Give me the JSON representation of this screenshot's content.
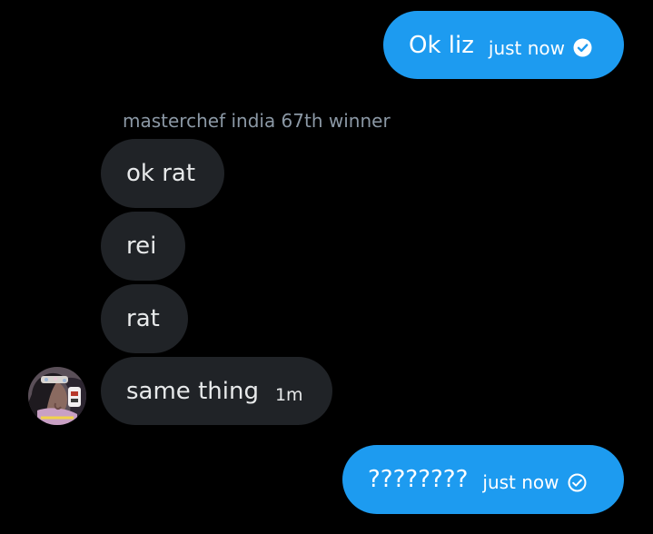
{
  "conversation": {
    "messages": [
      {
        "direction": "sent",
        "text": "Ok liz",
        "time": "just now",
        "status_icon": "read-check-icon"
      },
      {
        "direction": "received",
        "sender": "masterchef india 67th winner",
        "text": "ok rat"
      },
      {
        "direction": "received",
        "text": "rei"
      },
      {
        "direction": "received",
        "text": "rat"
      },
      {
        "direction": "received",
        "text": "same thing",
        "time": "1m",
        "avatar": "avatar"
      },
      {
        "direction": "sent",
        "text": "????????",
        "time": "just now",
        "status_icon": "sent-check-icon"
      }
    ]
  },
  "colors": {
    "background": "#000000",
    "sent_bubble": "#1d9bf0",
    "received_bubble": "#202327",
    "text_primary": "#e7e9ea",
    "text_secondary": "#8b98a5"
  }
}
